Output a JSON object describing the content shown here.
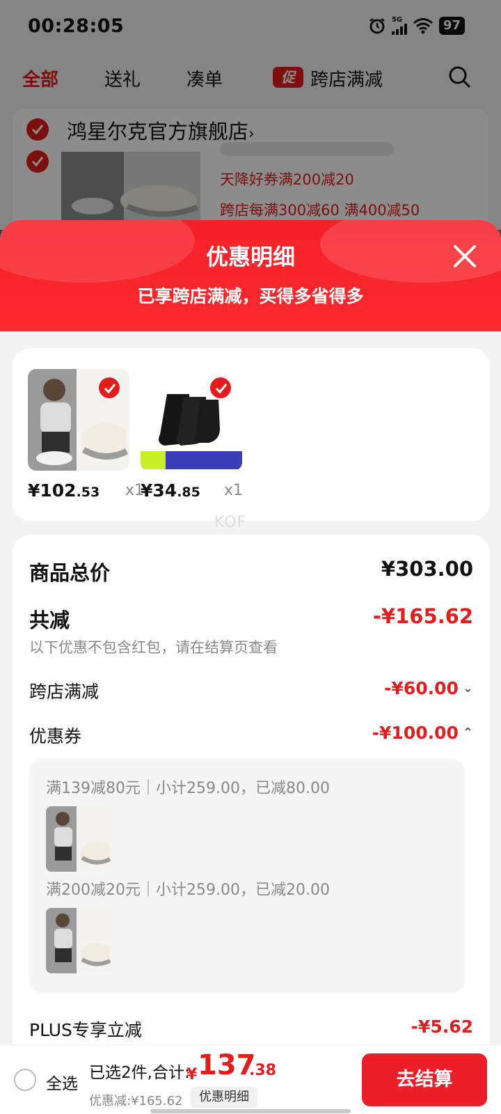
{
  "status_bar": {
    "time": "00:28:05",
    "network": "5G",
    "battery": "97"
  },
  "tabs": [
    {
      "label": "全部"
    },
    {
      "label": "送礼"
    },
    {
      "label": "凑单"
    },
    {
      "label": "跨店满减",
      "badge": "促"
    }
  ],
  "store": {
    "name": "鸿星尔克官方旗舰店",
    "chevron": "›",
    "promos": [
      "天降好券满200减20",
      "跨店每满300减60  满400减50"
    ]
  },
  "sheet": {
    "title": "优惠明细",
    "subtitle": "已享跨店满减，买得多省得多",
    "items": [
      {
        "price_int": "¥102",
        "price_dec": ".53",
        "qty": "x1",
        "image": "sneaker-photo"
      },
      {
        "price_int": "¥34",
        "price_dec": ".85",
        "qty": "x1",
        "image": "black-socks-photo"
      }
    ],
    "watermark": "KOF",
    "total_label": "商品总价",
    "total_value": "¥303.00",
    "discount_label": "共减",
    "discount_value": "-¥165.62",
    "discount_note": "以下优惠不包含红包，请在结算页查看",
    "cross_store_label": "跨店满减",
    "cross_store_value": "-¥60.00",
    "coupon_label": "优惠券",
    "coupon_value": "-¥100.00",
    "coupon_details": [
      {
        "text": "满139减80元｜小计259.00，已减80.00"
      },
      {
        "text": "满200减20元｜小计259.00，已减20.00"
      }
    ],
    "plus_label": "PLUS专享立减",
    "plus_value": "-¥5.62"
  },
  "bottom_bar": {
    "select_all": "全选",
    "selected_text": "已选2件,合计:",
    "currency": "¥",
    "total_int": "137",
    "total_dec": ".38",
    "saved_text": "优惠减:¥165.62",
    "detail_button": "优惠明细",
    "checkout_button": "去结算"
  },
  "colors": {
    "accent": "#e31d1d",
    "header_red": "#f4202a"
  }
}
